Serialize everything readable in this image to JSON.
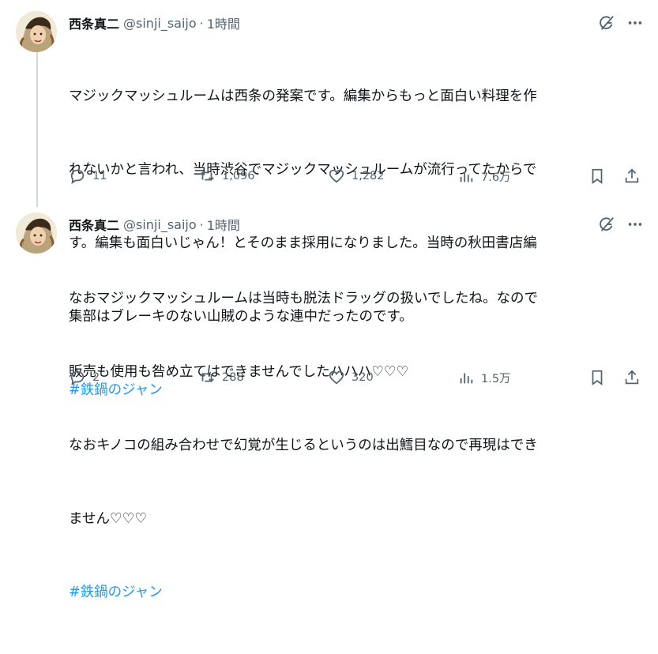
{
  "tweets": [
    {
      "name": "西条真二",
      "handle": "@sinji_saijo",
      "dot": "·",
      "time": "1時間",
      "body_lines": [
        "マジックマッシュルームは西条の発案です。編集からもっと面白い料理を作",
        "れないかと言われ、当時渋谷でマジックマッシュルームが流行ってたからで",
        "す。編集も面白いじゃん！とそのまま採用になりました。当時の秋田書店編",
        "集部はブレーキのない山賊のような連中だったのです。"
      ],
      "hashtag": "#鉄鍋のジャン",
      "replies": "11",
      "reposts": "1,096",
      "likes": "1,282",
      "views": "7.6万"
    },
    {
      "name": "西条真二",
      "handle": "@sinji_saijo",
      "dot": "·",
      "time": "1時間",
      "body_lines": [
        "なおマジックマッシュルームは当時も脱法ドラッグの扱いでしたね。なので",
        "販売も使用も咎め立てはできませんでしたハハハ♡♡♡",
        "なおキノコの組み合わせで幻覚が生じるというのは出鱈目なので再現はでき",
        "ません♡♡♡"
      ],
      "hashtag": "#鉄鍋のジャン",
      "replies": "2",
      "reposts": "288",
      "likes": "320",
      "views": "1.5万"
    }
  ],
  "icons": {
    "grok": "grok-icon",
    "more": "more-icon",
    "reply": "reply-icon",
    "repost": "repost-icon",
    "like": "heart-icon",
    "views": "views-icon",
    "bookmark": "bookmark-icon",
    "share": "share-icon"
  },
  "colors": {
    "text": "#0f1419",
    "secondary": "#536471",
    "link": "#1d9bf0",
    "thread_line": "#cfd9de"
  }
}
